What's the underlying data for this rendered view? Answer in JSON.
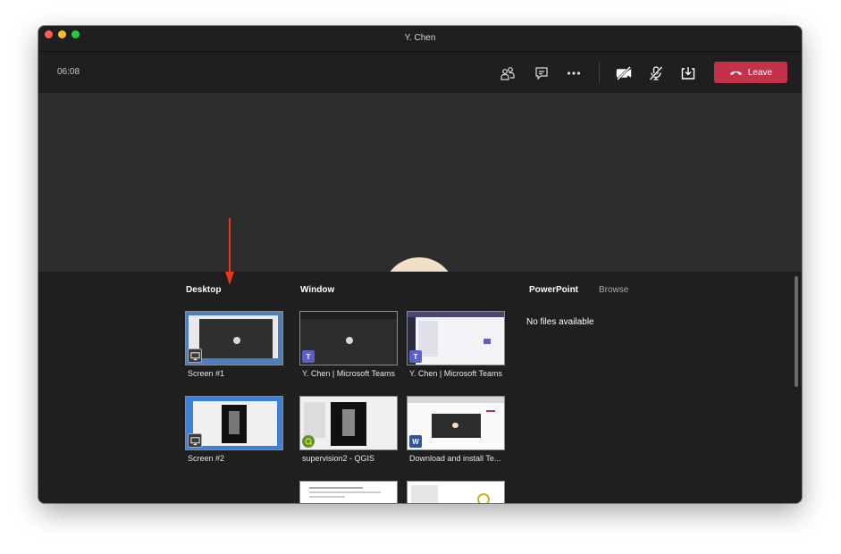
{
  "window": {
    "title": "Y. Chen"
  },
  "toolbar": {
    "timer": "06:08",
    "icons": [
      "people-icon",
      "chat-icon",
      "more-icon",
      "camera-off-icon",
      "mic-off-icon",
      "share-tray-icon"
    ],
    "leave_label": "Leave",
    "leave_color": "#c4314b"
  },
  "share": {
    "desktop": {
      "heading": "Desktop",
      "tiles": [
        {
          "label": "Screen #1"
        },
        {
          "label": "Screen #2"
        }
      ]
    },
    "window": {
      "heading": "Window",
      "tiles": [
        {
          "label": "Y. Chen | Microsoft Teams",
          "app": "teams"
        },
        {
          "label": "Y. Chen | Microsoft Teams",
          "app": "teams"
        },
        {
          "label": "supervision2 - QGIS",
          "app": "qgis"
        },
        {
          "label": "Download and install Te...",
          "app": "word"
        },
        {
          "label": "",
          "app": ""
        },
        {
          "label": "",
          "app": ""
        }
      ]
    },
    "powerpoint": {
      "heading": "PowerPoint",
      "browse_label": "Browse",
      "empty_message": "No files available"
    }
  },
  "colors": {
    "accent_red": "#c4314b",
    "arrow": "#e8351d",
    "teams_purple": "#5b5fc7"
  }
}
